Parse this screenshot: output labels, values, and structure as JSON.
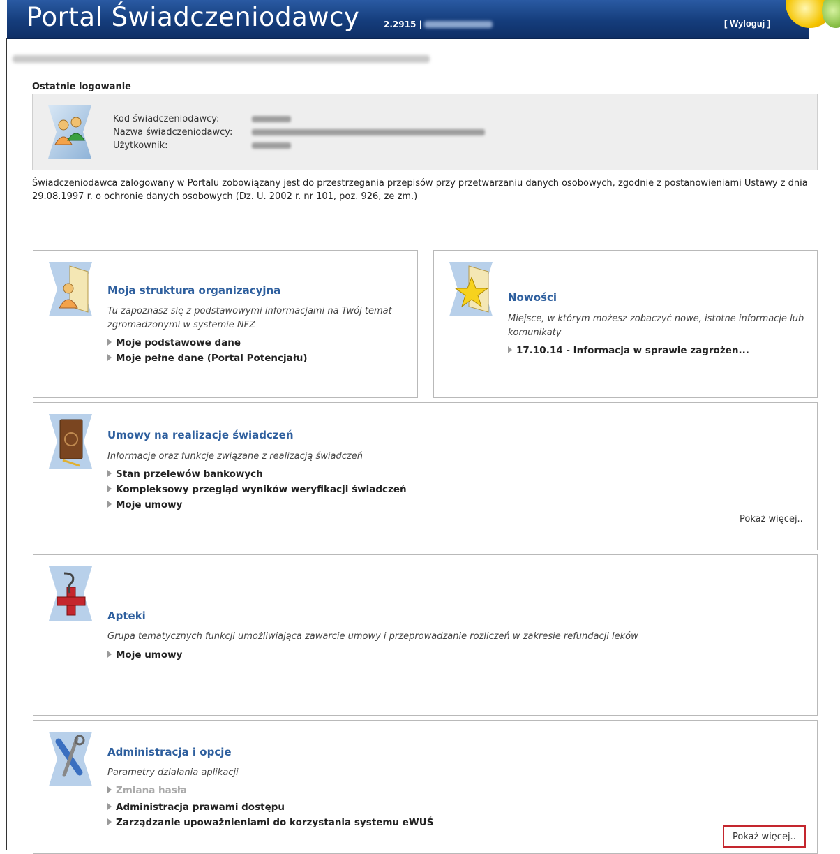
{
  "header": {
    "brand": "Portal Świadczeniodawcy",
    "version": "2.2915 |",
    "logout": "[ Wyloguj ]"
  },
  "last_login": {
    "title": "Ostatnie logowanie",
    "provider_code_label": "Kod świadczeniodawcy:",
    "provider_name_label": "Nazwa świadczeniodawcy:",
    "user_label": "Użytkownik:"
  },
  "notice": "Świadczeniodawca zalogowany w Portalu zobowiązany jest do przestrzegania przepisów przy przetwarzaniu danych osobowych, zgodnie z postanowieniami Ustawy z dnia 29.08.1997 r. o ochronie danych osobowych (Dz. U. 2002 r. nr 101, poz. 926, ze zm.)",
  "panels": {
    "structure": {
      "icon": "user-folder-icon",
      "title": "Moja struktura organizacyjna",
      "desc": "Tu zapoznasz się z podstawowymi informacjami na Twój temat zgromadzonymi w systemie NFZ",
      "links": [
        "Moje podstawowe dane",
        "Moje pełne dane (Portal Potencjału)"
      ]
    },
    "news": {
      "icon": "star-folder-icon",
      "title": "Nowości",
      "desc": "Miejsce, w którym możesz zobaczyć nowe, istotne informacje lub komunikaty",
      "links": [
        "17.10.14 - Informacja w sprawie zagrożen..."
      ]
    },
    "contracts": {
      "icon": "book-icon",
      "title": "Umowy na realizacje świadczeń",
      "desc": "Informacje oraz funkcje związane z realizacją świadczeń",
      "links": [
        "Stan przelewów bankowych",
        "Kompleksowy przegląd wyników weryfikacji świadczeń",
        "Moje umowy"
      ],
      "more": "Pokaż więcej.."
    },
    "pharmacies": {
      "icon": "pharmacy-cross-icon",
      "title": "Apteki",
      "desc": "Grupa tematycznych funkcji umożliwiająca zawarcie umowy i przeprowadzanie rozliczeń w zakresie refundacji leków",
      "links": [
        "Moje umowy"
      ]
    },
    "admin": {
      "icon": "tools-icon",
      "title": "Administracja i opcje",
      "desc": "Parametry działania aplikacji",
      "links": [
        "Zmiana hasła",
        "Administracja prawami dostępu",
        "Zarządzanie upoważnieniami do korzystania systemu eWUŚ"
      ],
      "more": "Pokaż więcej.."
    }
  },
  "colors": {
    "header_blue": "#1a4486",
    "title_blue": "#2e5f9e",
    "highlight_red": "#c4262e"
  }
}
